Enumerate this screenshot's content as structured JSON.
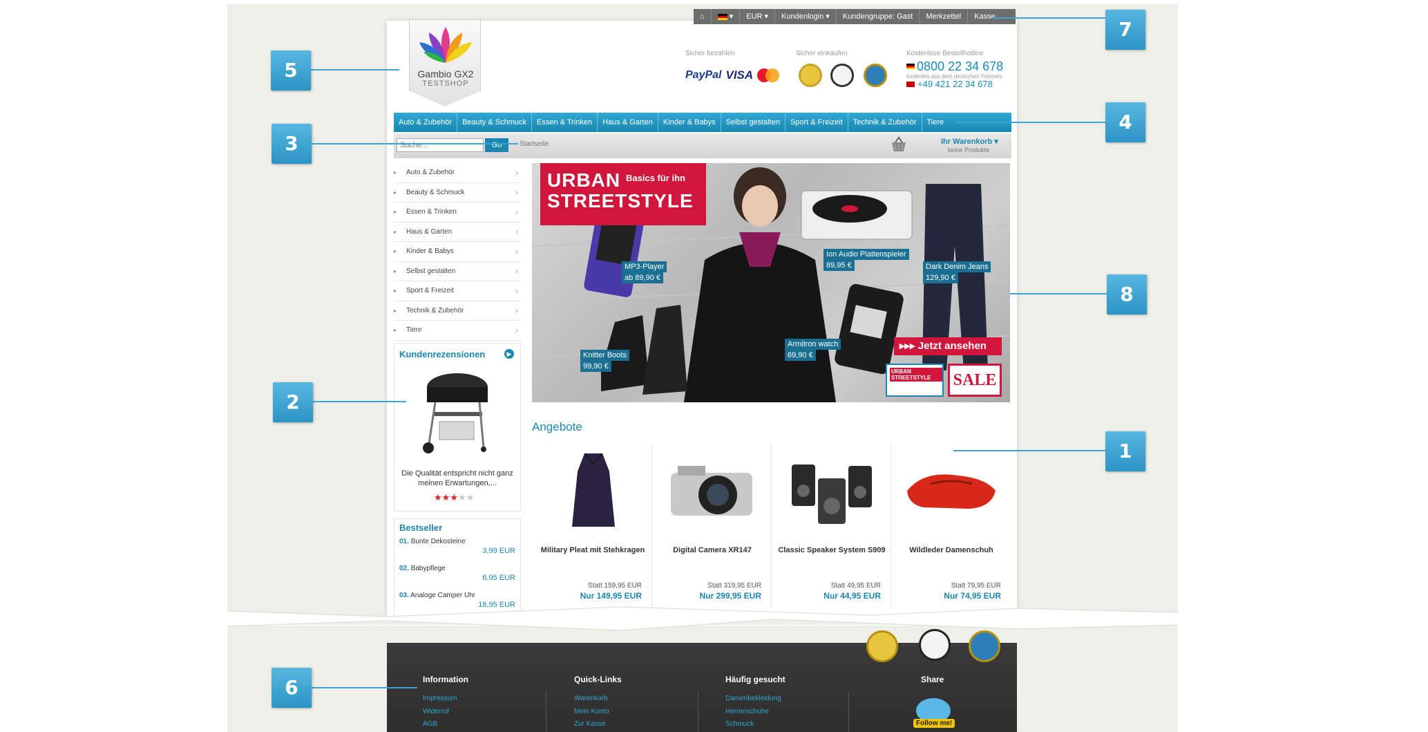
{
  "topbar": {
    "home": "⌂",
    "currency": "EUR",
    "login": "Kundenlogin",
    "group": "Kundengruppe: Gast",
    "wishlist": "Merkzettel",
    "checkout": "Kasse"
  },
  "logo": {
    "line1": "Gambio GX2",
    "line2": "TESTSHOP"
  },
  "header": {
    "pay_label": "Sicher bezahlen",
    "pay_paypal": "PayPal",
    "pay_visa": "VISA",
    "shop_label": "Sicher einkaufen",
    "hotline_label": "Kostenlose Bestellhotline",
    "hotline_number": "0800 22 34 678",
    "hotline_sub": "kostenlos aus dem deutschen Festnetz",
    "hotline_number2": "+49 421 22 34 678"
  },
  "nav": [
    "Auto & Zubehör",
    "Beauty & Schmuck",
    "Essen & Trinken",
    "Haus & Garten",
    "Kinder & Babys",
    "Selbst gestalten",
    "Sport & Freizeit",
    "Technik & Zubehör",
    "Tiere"
  ],
  "search": {
    "placeholder": "Suche...",
    "button": "Go",
    "breadcrumb": "Startseite"
  },
  "cart": {
    "title": "Ihr Warenkorb",
    "subtitle": "keine Produkte"
  },
  "categories": [
    "Auto & Zubehör",
    "Beauty & Schmuck",
    "Essen & Trinken",
    "Haus & Garten",
    "Kinder & Babys",
    "Selbst gestalten",
    "Sport & Freizeit",
    "Technik & Zubehör",
    "Tiere"
  ],
  "reviews": {
    "title": "Kundenrezensionen",
    "text": "Die Qualität entspricht nicht ganz meinen Erwartungen,...",
    "rating": 3,
    "rating_max": 5
  },
  "bestseller": {
    "title": "Bestseller",
    "items": [
      {
        "rank": "01.",
        "name": "Bunte Dekosteine",
        "price": "3,99 EUR"
      },
      {
        "rank": "02.",
        "name": "Babypflege",
        "price": "6,95 EUR"
      },
      {
        "rank": "03.",
        "name": "Analoge Camper Uhr",
        "price": "18,95 EUR"
      }
    ]
  },
  "hero": {
    "title1": "URBAN",
    "title2": "STREETSTYLE",
    "subtitle": "Basics für ihn",
    "cta": "▸▸▸ Jetzt ansehen",
    "sale": "SALE",
    "mini_banner": "URBAN STREETSTYLE",
    "products": [
      {
        "name": "MP3-Player",
        "price": "ab 89,90 €"
      },
      {
        "name": "Ion Audio Plattenspieler",
        "price": "89,95 €"
      },
      {
        "name": "Dark Denim Jeans",
        "price": "129,90 €"
      },
      {
        "name": "Knitter Boots",
        "price": "99,90 €"
      },
      {
        "name": "Armitron watch",
        "price": "69,90 €"
      }
    ]
  },
  "offers": {
    "title": "Angebote",
    "items": [
      {
        "name": "Military Pleat mit Stehkragen",
        "old": "Statt 159,95 EUR",
        "new": "Nur 149,95 EUR"
      },
      {
        "name": "Digital Camera XR147",
        "old": "Statt 319,95 EUR",
        "new": "Nur 299,95 EUR"
      },
      {
        "name": "Classic Speaker System S909",
        "old": "Statt 49,95 EUR",
        "new": "Nur 44,95 EUR"
      },
      {
        "name": "Wildleder Damenschuh",
        "old": "Statt 79,95 EUR",
        "new": "Nur 74,95 EUR"
      }
    ]
  },
  "footer": {
    "information": {
      "title": "Information",
      "links": [
        "Impressum",
        "Widerruf",
        "AGB"
      ]
    },
    "quicklinks": {
      "title": "Quick-Links",
      "links": [
        "Warenkorb",
        "Mein Konto",
        "Zur Kasse"
      ]
    },
    "popular": {
      "title": "Häufig gesucht",
      "links": [
        "Damenbekleidung",
        "Herrenschuhe",
        "Schmuck"
      ]
    },
    "share": {
      "title": "Share",
      "follow": "Follow me!"
    }
  },
  "callouts": [
    "1",
    "2",
    "3",
    "4",
    "5",
    "6",
    "7",
    "8"
  ],
  "colors": {
    "accent": "#1b86b0",
    "sale_red": "#d0163a",
    "callout": "#2c94c6"
  }
}
